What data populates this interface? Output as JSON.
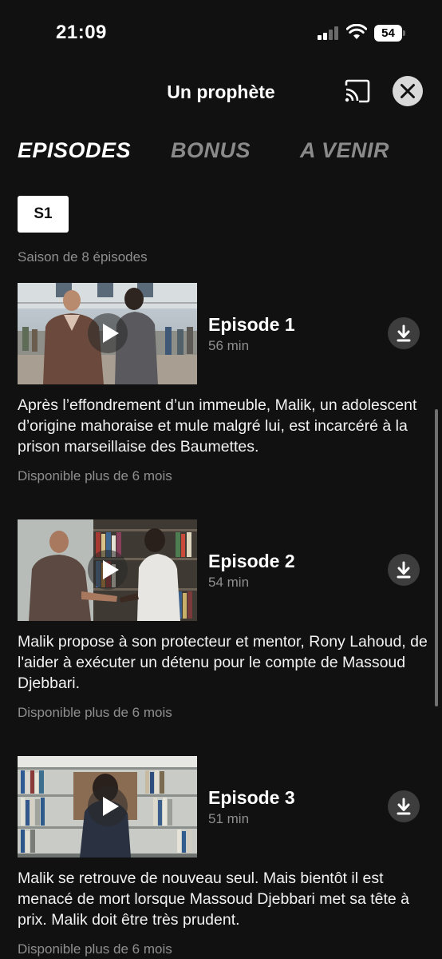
{
  "status_bar": {
    "time": "21:09",
    "battery_level": "54"
  },
  "header": {
    "title": "Un prophète",
    "cast_icon": "cast-icon",
    "close_icon": "close-icon"
  },
  "tabs": [
    {
      "label": "EPISODES",
      "active": true
    },
    {
      "label": "BONUS",
      "active": false
    },
    {
      "label": "A VENIR",
      "active": false
    }
  ],
  "season": {
    "selected": "S1",
    "info": "Saison de 8 épisodes"
  },
  "episodes": [
    {
      "title": "Episode 1",
      "duration": "56 min",
      "description": "Après l’effondrement d’un immeuble, Malik, un adolescent d’origine mahoraise et mule malgré lui, est incarcéré à la prison marseillaise des Baumettes.",
      "availability": "Disponible plus de 6 mois"
    },
    {
      "title": "Episode 2",
      "duration": "54 min",
      "description": "Malik propose à son protecteur et mentor, Rony Lahoud, de l'aider à exécuter un détenu pour le compte de Massoud Djebbari.",
      "availability": "Disponible plus de 6 mois"
    },
    {
      "title": "Episode 3",
      "duration": "51 min",
      "description": "Malik se retrouve de nouveau seul. Mais bientôt il est menacé de mort lorsque Massoud Djebbari met sa tête à prix. Malik doit être très prudent.",
      "availability": "Disponible plus de 6 mois"
    }
  ],
  "colors": {
    "background": "#111111",
    "active_tab": "#ffffff",
    "inactive_tab": "#8a8a8a",
    "secondary_text": "#8f8f8f",
    "download_button_bg": "#3d3d3d",
    "close_button_bg": "#d9d9d9"
  }
}
